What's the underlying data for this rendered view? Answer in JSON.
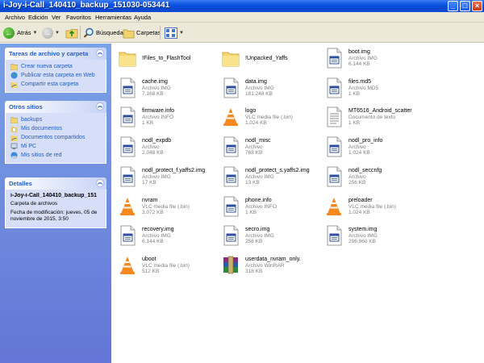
{
  "window": {
    "title": "i-Joy-i-Call_140410_backup_151030-053441"
  },
  "menu": [
    "Archivo",
    "Edición",
    "Ver",
    "Favoritos",
    "Herramientas",
    "Ayuda"
  ],
  "toolbar": {
    "back_label": "Atrás",
    "search_label": "Búsqueda",
    "folders_label": "Carpetas"
  },
  "sidebar": {
    "tasks": {
      "title": "Tareas de archivo y carpeta",
      "items": [
        "Crear nueva carpeta",
        "Publicar esta carpeta en Web",
        "Compartir esta carpeta"
      ]
    },
    "places": {
      "title": "Otros sitios",
      "items": [
        "backups",
        "Mis documentos",
        "Documentos compartidos",
        "Mi PC",
        "Mis sitios de red"
      ]
    },
    "details": {
      "title": "Detalles",
      "name": "i-Joy-i-Call_140410_backup_151",
      "type": "Carpeta de archivos",
      "modified": "Fecha de modificación: jueves, 05 de noviembre de 2015, 3:50"
    }
  },
  "files": [
    {
      "name": "!Files_to_FlashTool",
      "type": "",
      "size": "",
      "icon": "folder-icon"
    },
    {
      "name": "!Unpacked_Yaffs",
      "type": "",
      "size": "",
      "icon": "folder-icon"
    },
    {
      "name": "boot.img",
      "type": "Archivo IMG",
      "size": "6.144 KB",
      "icon": "file-icon"
    },
    {
      "name": "cache.img",
      "type": "Archivo IMG",
      "size": "7.168 KB",
      "icon": "file-icon"
    },
    {
      "name": "data.img",
      "type": "Archivo IMG",
      "size": "181.248 KB",
      "icon": "file-icon"
    },
    {
      "name": "files.md5",
      "type": "Archivo MD5",
      "size": "1 KB",
      "icon": "file-icon"
    },
    {
      "name": "firmware.info",
      "type": "Archivo INFO",
      "size": "1 KB",
      "icon": "file-icon"
    },
    {
      "name": "logo",
      "type": "VLC media file (.bin)",
      "size": "1.024 KB",
      "icon": "vlc-icon"
    },
    {
      "name": "MT6516_Android_scatter",
      "type": "Documento de texto",
      "size": "1 KB",
      "icon": "text-document-icon"
    },
    {
      "name": "nodl_expdb",
      "type": "Archivo",
      "size": "2.048 KB",
      "icon": "file-icon"
    },
    {
      "name": "nodl_misc",
      "type": "Archivo",
      "size": "768 KB",
      "icon": "file-icon"
    },
    {
      "name": "nodl_pro_info",
      "type": "Archivo",
      "size": "1.024 KB",
      "icon": "file-icon"
    },
    {
      "name": "nodl_protect_f.yaffs2.img",
      "type": "Archivo IMG",
      "size": "17 KB",
      "icon": "file-icon"
    },
    {
      "name": "nodl_protect_s.yaffs2.img",
      "type": "Archivo IMG",
      "size": "13 KB",
      "icon": "file-icon"
    },
    {
      "name": "nodl_seccnfg",
      "type": "Archivo",
      "size": "256 KB",
      "icon": "file-icon"
    },
    {
      "name": "nvram",
      "type": "VLC media file (.bin)",
      "size": "3.072 KB",
      "icon": "vlc-icon"
    },
    {
      "name": "phone.info",
      "type": "Archivo INFO",
      "size": "1 KB",
      "icon": "file-icon"
    },
    {
      "name": "preloader",
      "type": "VLC media file (.bin)",
      "size": "1.024 KB",
      "icon": "vlc-icon"
    },
    {
      "name": "recovery.img",
      "type": "Archivo IMG",
      "size": "6.144 KB",
      "icon": "file-icon"
    },
    {
      "name": "secro.img",
      "type": "Archivo IMG",
      "size": "256 KB",
      "icon": "file-icon"
    },
    {
      "name": "system.img",
      "type": "Archivo IMG",
      "size": "296.960 KB",
      "icon": "file-icon"
    },
    {
      "name": "uboot",
      "type": "VLC media file (.bin)",
      "size": "512 KB",
      "icon": "vlc-icon"
    },
    {
      "name": "userdata_nvram_only.",
      "type": "Archivo WinRAR",
      "size": "318 KB",
      "icon": "winrar-archive-icon"
    }
  ]
}
